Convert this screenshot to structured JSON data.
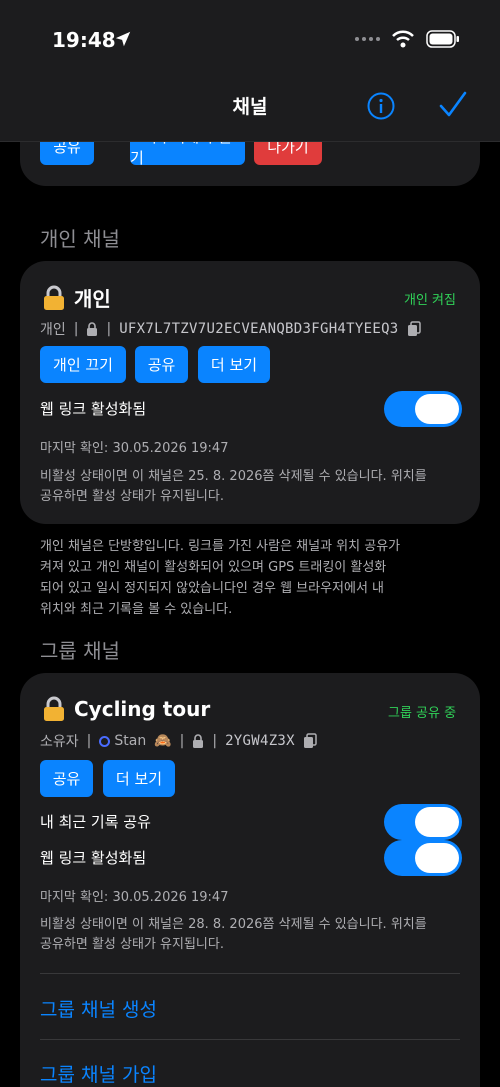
{
  "status_bar": {
    "time": "19:48"
  },
  "nav": {
    "title": "채널"
  },
  "top_partial_buttons": {
    "share": "공유",
    "browser": "브라우저에서 열기",
    "leave": "나가기"
  },
  "private_section": {
    "header": "개인 채널",
    "card": {
      "title": "개인",
      "status": "개인 켜짐",
      "owner_label": "개인",
      "code": "UFX7L7TZV7U2ECVEANQBD3FGH4TYEEQ3",
      "buttons": {
        "off": "개인 끄기",
        "share": "공유",
        "more": "더 보기"
      },
      "web_link_label": "웹 링크 활성화됨",
      "web_link_on": true,
      "last_check": "마지막 확인: 30.05.2026 19:47",
      "inactive_note_line1": "비활성 상태이면 이 채널은 25. 8. 2026쯤 삭제될 수 있습니다. 위치를",
      "inactive_note_line2": "공유하면 활성 상태가 유지됩니다."
    },
    "footnote_lines": [
      "개인 채널은 단방향입니다. 링크를 가진 사람은 채널과 위치 공유가",
      "켜져 있고 개인 채널이 활성화되어 있으며 GPS 트래킹이 활성화",
      "되어 있고 일시 정지되지 않았습니다인 경우 웹 브라우저에서 내",
      "위치와 최근 기록을 볼 수 있습니다."
    ]
  },
  "group_section": {
    "header": "그룹 채널",
    "card": {
      "title": "Cycling tour",
      "status": "그룹 공유 중",
      "owner_label": "소유자",
      "owner_name": "Stan",
      "owner_emoji": "🙈",
      "code": "2YGW4Z3X",
      "buttons": {
        "share": "공유",
        "more": "더 보기"
      },
      "share_history_label": "내 최근 기록 공유",
      "share_history_on": true,
      "web_link_label": "웹 링크 활성화됨",
      "web_link_on": true,
      "last_check": "마지막 확인: 30.05.2026 19:47",
      "inactive_note_line1": "비활성 상태이면 이 채널은 28. 8. 2026쯤 삭제될 수 있습니다. 위치를",
      "inactive_note_line2": "공유하면 활성 상태가 유지됩니다.",
      "create_link": "그룹 채널 생성",
      "join_link": "그룹 채널 가입"
    }
  },
  "colors": {
    "accent": "#0a84ff",
    "green": "#30d158",
    "red": "#e03c3c",
    "card": "#1c1c1e"
  }
}
